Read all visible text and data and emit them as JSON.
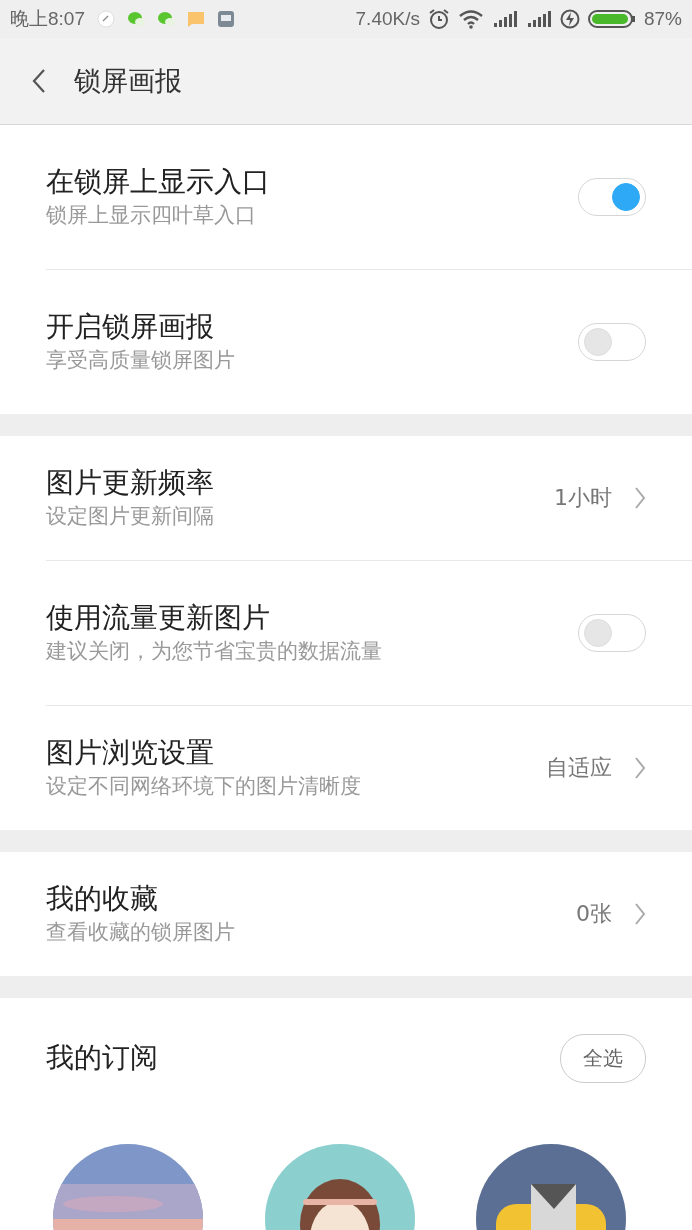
{
  "status_bar": {
    "time": "晚上8:07",
    "speed": "7.40K/s",
    "battery": "87%"
  },
  "header": {
    "title": "锁屏画报"
  },
  "sections": [
    {
      "rows": [
        {
          "kind": "toggle",
          "title": "在锁屏上显示入口",
          "subtitle": "锁屏上显示四叶草入口",
          "on": true
        },
        {
          "kind": "toggle",
          "title": "开启锁屏画报",
          "subtitle": "享受高质量锁屏图片",
          "on": false
        }
      ]
    },
    {
      "rows": [
        {
          "kind": "nav",
          "title": "图片更新频率",
          "subtitle": "设定图片更新间隔",
          "value": "1小时"
        },
        {
          "kind": "toggle",
          "title": "使用流量更新图片",
          "subtitle": "建议关闭，为您节省宝贵的数据流量",
          "on": false
        },
        {
          "kind": "nav",
          "title": "图片浏览设置",
          "subtitle": "设定不同网络环境下的图片清晰度",
          "value": "自适应"
        }
      ]
    },
    {
      "rows": [
        {
          "kind": "nav",
          "title": "我的收藏",
          "subtitle": "查看收藏的锁屏图片",
          "value": "0张"
        }
      ]
    }
  ],
  "subscriptions": {
    "title": "我的订阅",
    "select_all": "全选"
  }
}
